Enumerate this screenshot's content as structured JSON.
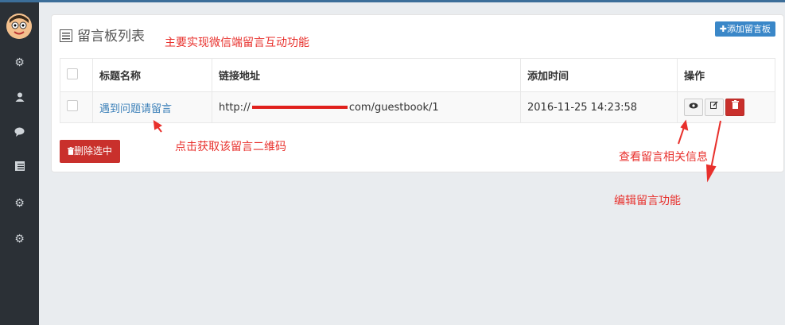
{
  "sidebar": {
    "icons": [
      "avatar",
      "gear-icon",
      "user-icon",
      "comment-icon",
      "list-icon",
      "gear-icon",
      "gear-icon"
    ]
  },
  "panel": {
    "title": "留言板列表",
    "add_button": "✚添加留言板"
  },
  "table": {
    "columns": [
      "",
      "标题名称",
      "链接地址",
      "添加时间",
      "操作"
    ],
    "rows": [
      {
        "title": "遇到问题请留言",
        "url_prefix": "http://",
        "url_suffix": "com/guestbook/1",
        "time": "2016-11-25 14:23:58"
      }
    ]
  },
  "delete_selected": "删除选中",
  "annotations": {
    "main": "主要实现微信端留言互动功能",
    "qr": "点击获取该留言二维码",
    "view": "查看留言相关信息",
    "edit": "编辑留言功能"
  },
  "colors": {
    "sidebar": "#2b3036",
    "primary": "#3a87c8",
    "danger": "#c9302c",
    "annotation": "#e8302c"
  }
}
